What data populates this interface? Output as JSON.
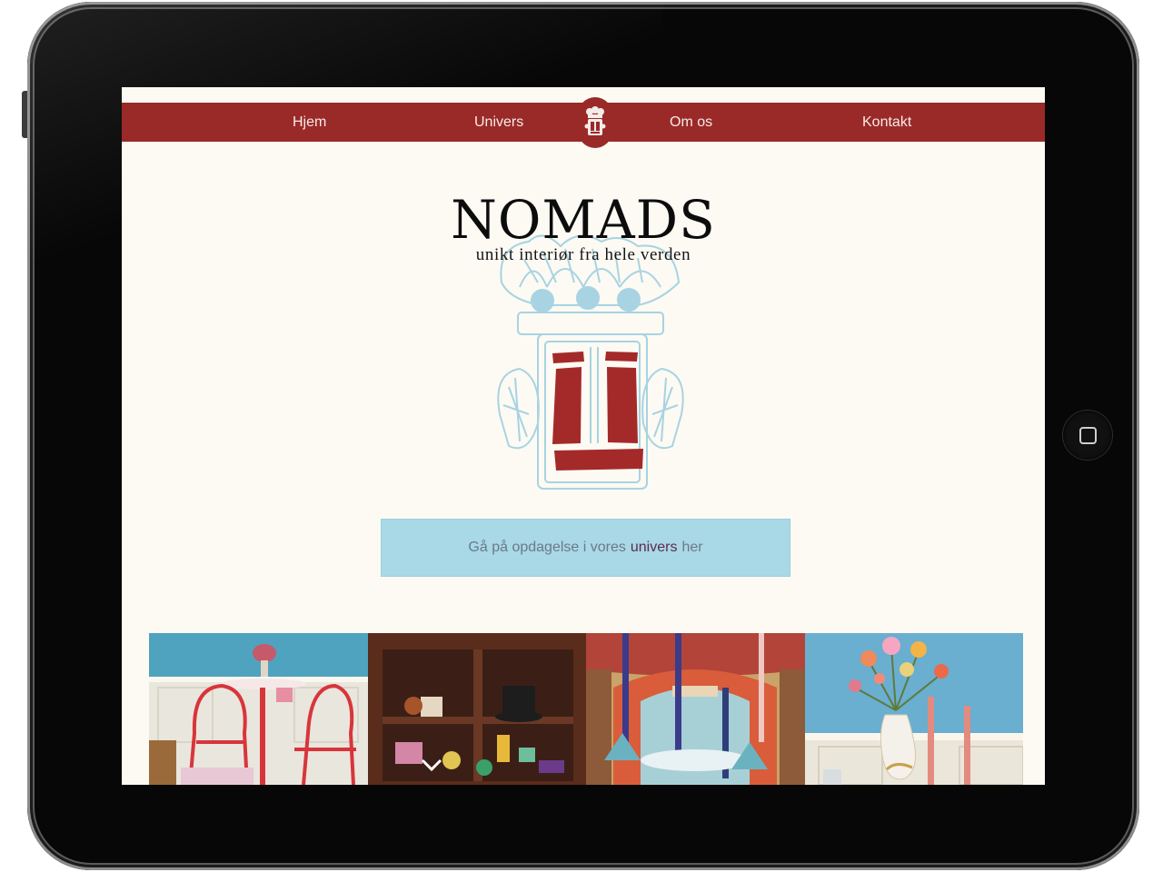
{
  "nav": {
    "links": [
      {
        "label": "Hjem"
      },
      {
        "label": "Univers"
      },
      {
        "label": "Om os"
      },
      {
        "label": "Kontakt"
      }
    ],
    "logo_icon": "nomads-totem-icon"
  },
  "hero": {
    "title": "NOMADS",
    "subtitle": "unikt interiør fra hele verden",
    "illustration_icon": "totem-mask-icon"
  },
  "cta": {
    "before": "Gå på opdagelse i vores",
    "link": "univers",
    "after": "her"
  },
  "gallery": [
    {
      "icon": "red-cafe-chairs-photo"
    },
    {
      "icon": "wooden-shelf-photo"
    },
    {
      "icon": "theatre-candles-photo"
    },
    {
      "icon": "flower-vase-photo"
    }
  ],
  "colors": {
    "nav_background": "#9a2a28",
    "page_background": "#fcfaf3",
    "cta_background": "#a9d8e7",
    "cta_link": "#5c2c4a",
    "logo_line": "#a8d3e2",
    "logo_fill": "#a42a2a"
  }
}
